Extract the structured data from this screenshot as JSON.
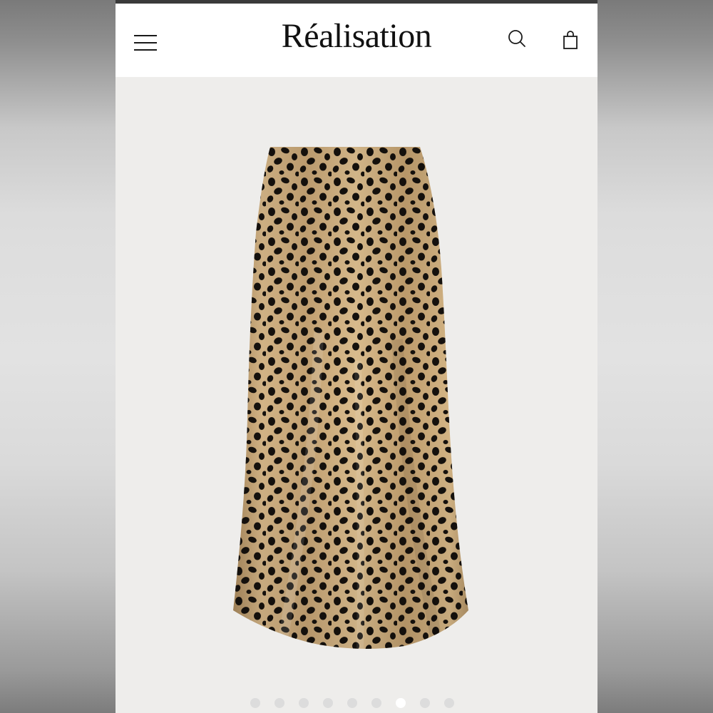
{
  "header": {
    "brand": "Réalisation",
    "menu_icon": "hamburger-menu-icon",
    "search_icon": "search-icon",
    "bag_icon": "shopping-bag-icon"
  },
  "product": {
    "image": "leopard-print-satin-midi-skirt",
    "print_colors": {
      "base": "#c9a878",
      "spots": "#14100c"
    }
  },
  "gallery": {
    "total_images": 9,
    "active_index": 7
  },
  "colors": {
    "header_bg": "#ffffff",
    "page_bg": "#eeedeb",
    "text": "#111111"
  }
}
